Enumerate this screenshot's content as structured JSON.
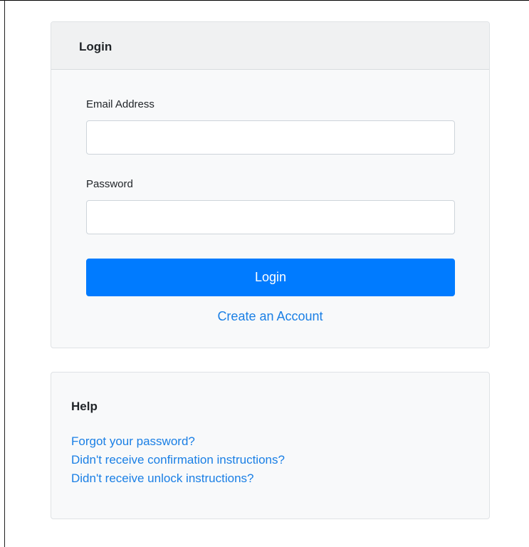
{
  "login_card": {
    "header_title": "Login",
    "email": {
      "label": "Email Address",
      "value": "",
      "placeholder": ""
    },
    "password": {
      "label": "Password",
      "value": "",
      "placeholder": ""
    },
    "submit_label": "Login",
    "create_account_label": "Create an Account"
  },
  "help_card": {
    "title": "Help",
    "links": [
      {
        "label": "Forgot your password?"
      },
      {
        "label": "Didn't receive confirmation instructions?"
      },
      {
        "label": "Didn't receive unlock instructions?"
      }
    ]
  },
  "colors": {
    "primary": "#007bff",
    "link": "#1a7fe5",
    "card_background": "#f8f9fa",
    "card_header_background": "#f0f1f2"
  }
}
